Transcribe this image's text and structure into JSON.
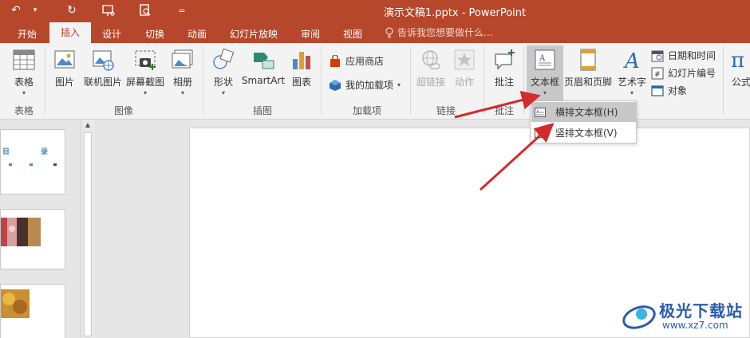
{
  "window": {
    "title": "演示文稿1.pptx - PowerPoint",
    "qat_undo": "↶",
    "qat_more": "▾",
    "qat_redo": "↻",
    "qat_customize": "="
  },
  "tabs": [
    {
      "label": "开始"
    },
    {
      "label": "插入"
    },
    {
      "label": "设计"
    },
    {
      "label": "切换"
    },
    {
      "label": "动画"
    },
    {
      "label": "幻灯片放映"
    },
    {
      "label": "审阅"
    },
    {
      "label": "视图"
    }
  ],
  "tellme": {
    "placeholder": "告诉我您想要做什么..."
  },
  "ribbon": {
    "table": {
      "label": "表格",
      "group": "表格"
    },
    "images": {
      "picture": "图片",
      "online_picture": "联机图片",
      "screenshot": "屏幕截图",
      "album": "相册",
      "group": "图像"
    },
    "illustrations": {
      "shapes": "形状",
      "smartart": "SmartArt",
      "chart": "图表",
      "group": "插图"
    },
    "addins": {
      "store": "应用商店",
      "my_addins": "我的加载项",
      "group": "加载项"
    },
    "links": {
      "hyperlink": "超链接",
      "action": "动作",
      "group": "链接"
    },
    "comments": {
      "comment": "批注",
      "group": "批注"
    },
    "text": {
      "textbox": "文本框",
      "header_footer": "页眉和页脚",
      "wordart": "艺术字",
      "datetime": "日期和时间",
      "slide_number": "幻灯片编号",
      "object": "对象"
    },
    "symbols": {
      "equation": "公式"
    }
  },
  "dropdown": {
    "items": [
      {
        "label": "横排文本框(H)"
      },
      {
        "label": "竖排文本框(V)"
      }
    ]
  },
  "thumbnails": {
    "thumb1_text_a": "目",
    "thumb1_text_b": "录"
  },
  "watermark": {
    "name": "极光下载站",
    "url": "www.xz7.com"
  },
  "colors": {
    "accent": "#b7472a",
    "ribbon_bg": "#f3f3f3",
    "arrow": "#d42a2a",
    "watermark": "#2a5cad"
  }
}
